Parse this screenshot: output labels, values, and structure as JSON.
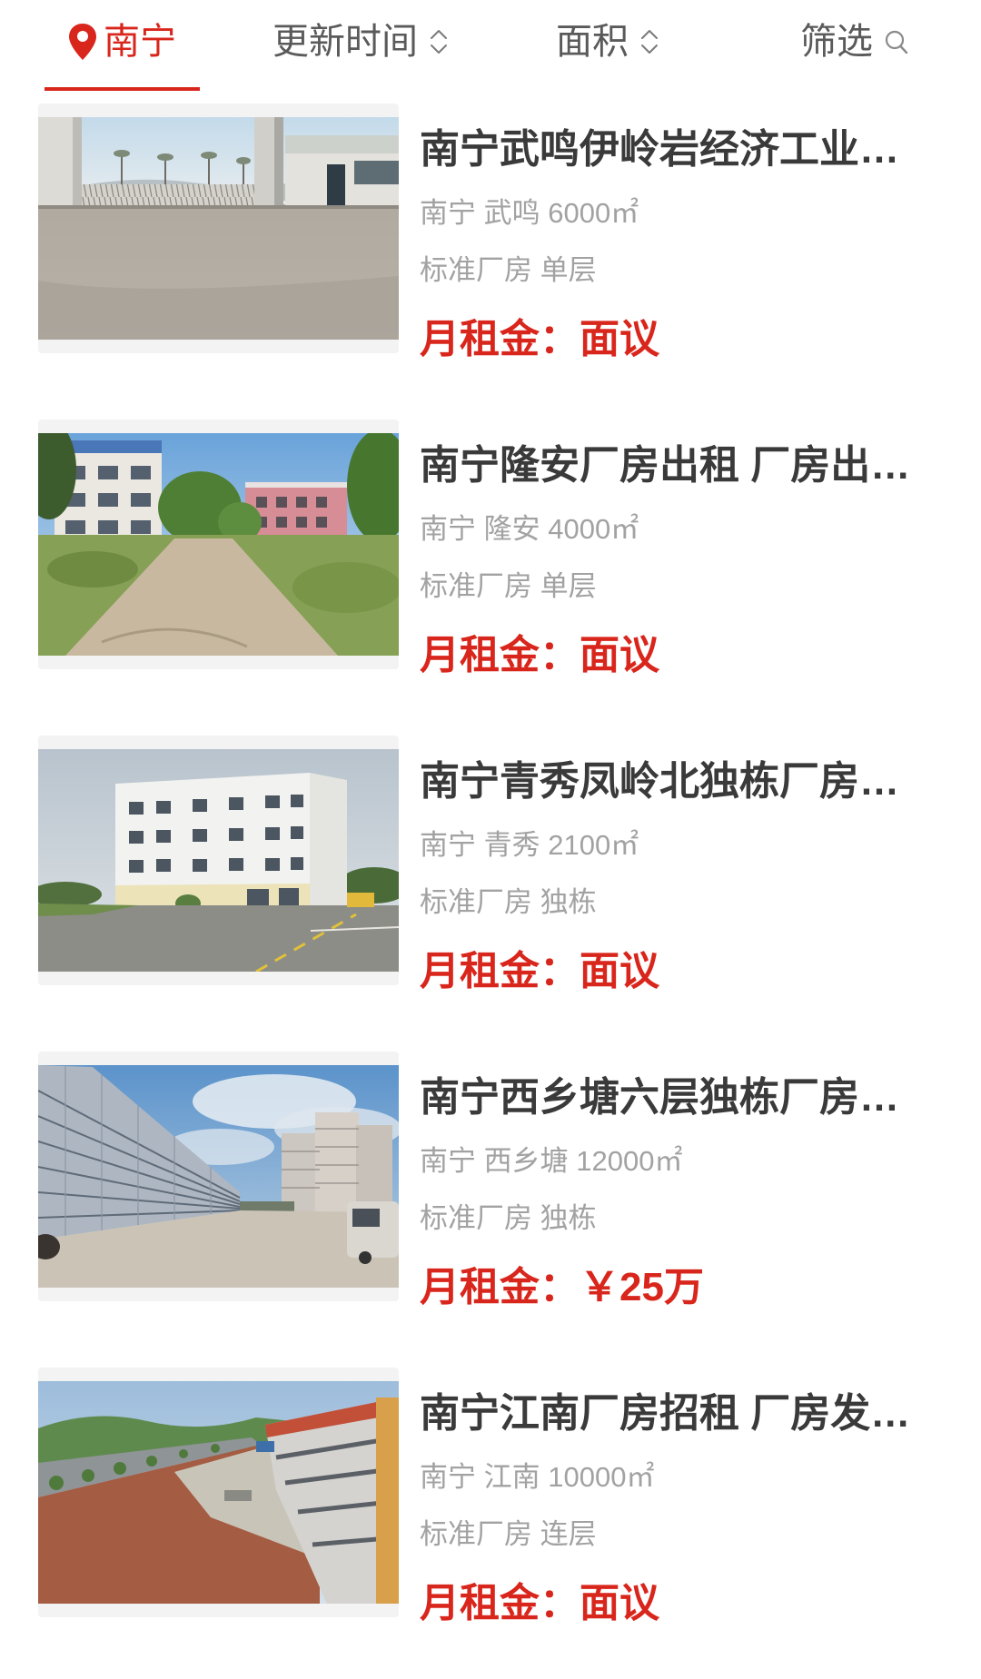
{
  "colors": {
    "accent": "#d9261c",
    "title": "#3a3a3a",
    "meta": "#a2a2a2",
    "nav": "#5a5a5a"
  },
  "filter_bar": {
    "location": {
      "label": "南宁",
      "icon": "location-pin-icon",
      "active": true
    },
    "sort_time": {
      "label": "更新时间",
      "icon": "sort-chevrons-icon"
    },
    "sort_area": {
      "label": "面积",
      "icon": "sort-chevrons-icon"
    },
    "filter": {
      "label": "筛选",
      "icon": "search-icon"
    }
  },
  "listings": [
    {
      "title": "南宁武鸣伊岭岩经济工业…",
      "city": "南宁",
      "district": "武鸣",
      "area": "6000㎡",
      "category": "标准厂房",
      "floor_type": "单层",
      "price_label": "月租金：",
      "price": "面议"
    },
    {
      "title": "南宁隆安厂房出租 厂房出…",
      "city": "南宁",
      "district": "隆安",
      "area": "4000㎡",
      "category": "标准厂房",
      "floor_type": "单层",
      "price_label": "月租金：",
      "price": "面议"
    },
    {
      "title": "南宁青秀凤岭北独栋厂房…",
      "city": "南宁",
      "district": "青秀",
      "area": "2100㎡",
      "category": "标准厂房",
      "floor_type": "独栋",
      "price_label": "月租金：",
      "price": "面议"
    },
    {
      "title": "南宁西乡塘六层独栋厂房…",
      "city": "南宁",
      "district": "西乡塘",
      "area": "12000㎡",
      "category": "标准厂房",
      "floor_type": "独栋",
      "price_label": "月租金：",
      "price": "￥25万"
    },
    {
      "title": "南宁江南厂房招租 厂房发…",
      "city": "南宁",
      "district": "江南",
      "area": "10000㎡",
      "category": "标准厂房",
      "floor_type": "连层",
      "price_label": "月租金：",
      "price": "面议"
    }
  ]
}
